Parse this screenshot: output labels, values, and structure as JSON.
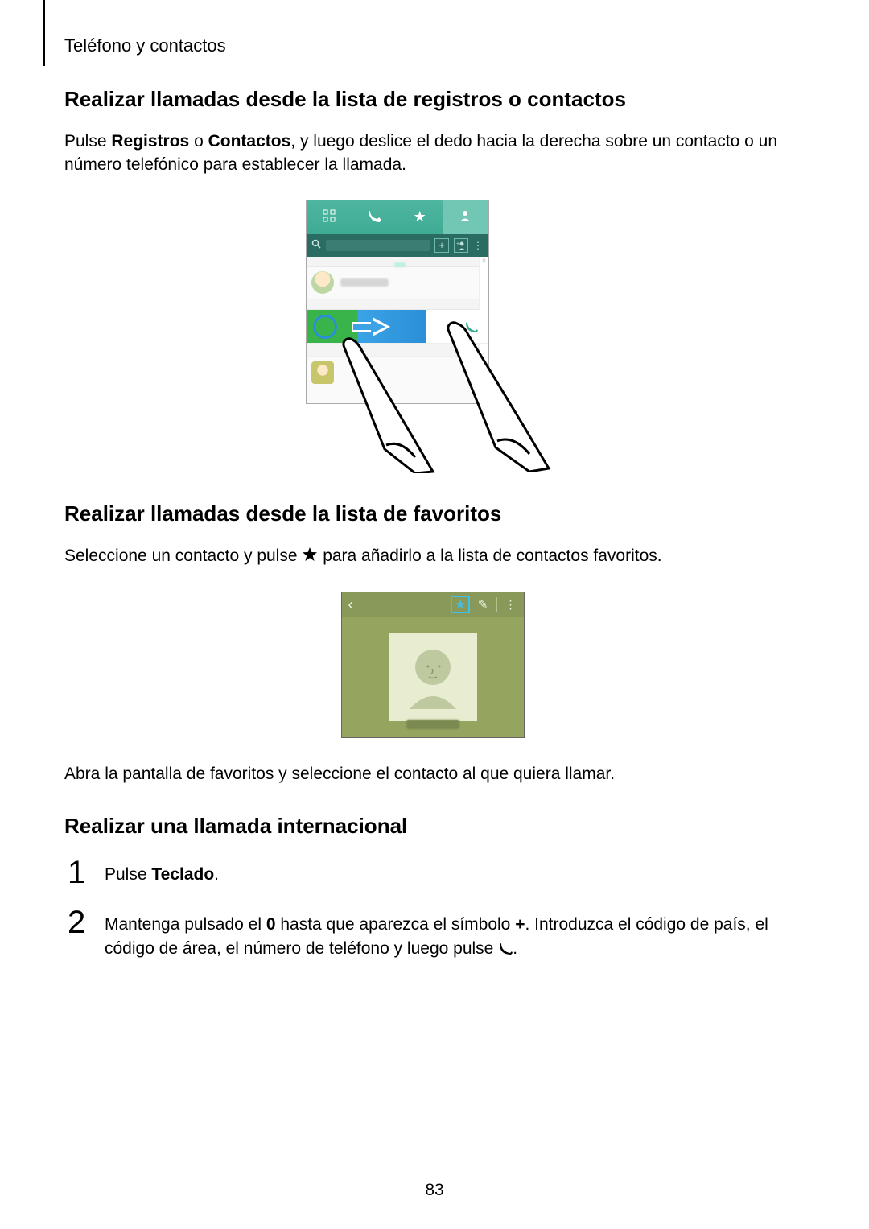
{
  "header": {
    "breadcrumb": "Teléfono y contactos"
  },
  "section1": {
    "heading": "Realizar llamadas desde la lista de registros o contactos",
    "p1a": "Pulse ",
    "p1b": "Registros",
    "p1c": " o ",
    "p1d": "Contactos",
    "p1e": ", y luego deslice el dedo hacia la derecha sobre un contacto o un número telefónico para establecer la llamada."
  },
  "section2": {
    "heading": "Realizar llamadas desde la lista de favoritos",
    "p1a": "Seleccione un contacto y pulse ",
    "p1b": " para añadirlo a la lista de contactos favoritos.",
    "p2": "Abra la pantalla de favoritos y seleccione el contacto al que quiera llamar."
  },
  "section3": {
    "heading": "Realizar una llamada internacional",
    "steps": [
      {
        "num": "1",
        "a": "Pulse ",
        "b": "Teclado",
        "c": "."
      },
      {
        "num": "2",
        "a": "Mantenga pulsado el ",
        "b": "0",
        "c": " hasta que aparezca el símbolo ",
        "d": "+",
        "e": ". Introduzca el código de país, el código de área, el número de teléfono y luego pulse ",
        "f": "."
      }
    ]
  },
  "page": {
    "number": "83"
  }
}
